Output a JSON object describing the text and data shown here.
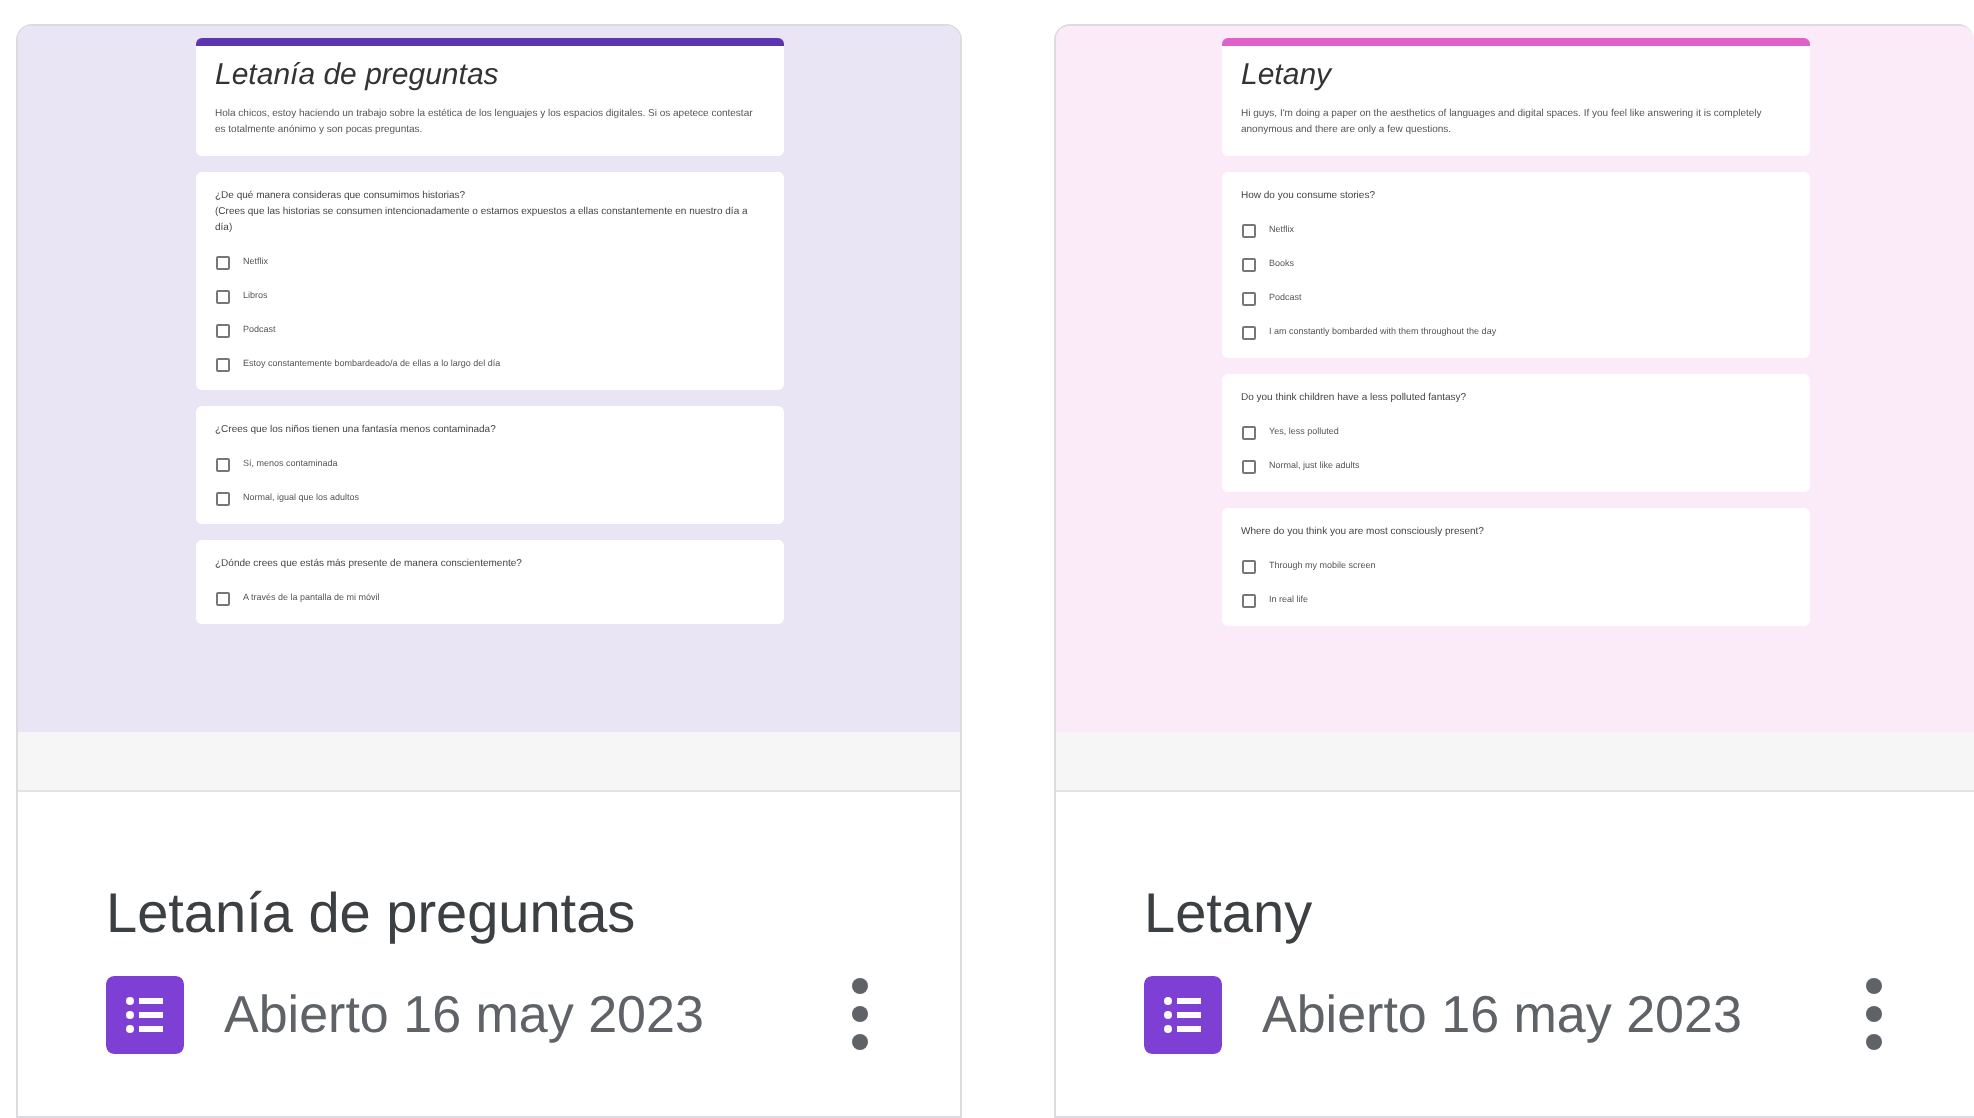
{
  "cards": [
    {
      "title": "Letanía de preguntas",
      "opened": "Abierto 16 may 2023",
      "color": "#5e35b1",
      "preview": {
        "title": "Letanía de preguntas",
        "description": "Hola chicos, estoy haciendo un trabajo sobre la estética de los lenguajes y los espacios digitales. Si os apetece contestar es totalmente anónimo y son pocas preguntas.",
        "questions": [
          {
            "text": "¿De qué manera consideras que consumimos historias?",
            "note": "(Crees que las historias se consumen intencionadamente o estamos expuestos a ellas constantemente en nuestro día a día)",
            "options": [
              {
                "label": "Netflix",
                "checked": false
              },
              {
                "label": "Libros",
                "checked": false
              },
              {
                "label": "Podcast",
                "checked": false
              },
              {
                "label": "Estoy constantemente bombardeado/a de ellas a lo largo del día",
                "checked": false
              }
            ]
          },
          {
            "text": "¿Crees que los niños tienen una fantasía menos contaminada?",
            "options": [
              {
                "label": "Sí, menos contaminada",
                "checked": false
              },
              {
                "label": "Normal, igual que los adultos",
                "checked": false
              }
            ]
          },
          {
            "text": "¿Dónde crees que estás más presente de manera conscientemente?",
            "options": [
              {
                "label": "A través de la pantalla de mi móvil",
                "checked": false
              }
            ]
          }
        ]
      }
    },
    {
      "title": "Letany",
      "opened": "Abierto 16 may 2023",
      "color": "#e060c8",
      "preview": {
        "title": "Letany",
        "description": "Hi guys, I'm doing a paper on the aesthetics of languages and digital spaces. If you feel like answering it is completely anonymous and there are only a few questions.",
        "questions": [
          {
            "text": "How do you consume stories?",
            "options": [
              {
                "label": "Netflix",
                "checked": false
              },
              {
                "label": "Books",
                "checked": false
              },
              {
                "label": "Podcast",
                "checked": false
              },
              {
                "label": "I am constantly bombarded with them throughout the day",
                "checked": false
              }
            ]
          },
          {
            "text": "Do you think children have a less polluted fantasy?",
            "options": [
              {
                "label": "Yes, less polluted",
                "checked": false
              },
              {
                "label": "Normal, just like adults",
                "checked": false
              }
            ]
          },
          {
            "text": "Where do you think you are most consciously present?",
            "options": [
              {
                "label": "Through my mobile screen",
                "checked": false
              },
              {
                "label": "In real life",
                "checked": false
              }
            ]
          }
        ]
      }
    }
  ]
}
